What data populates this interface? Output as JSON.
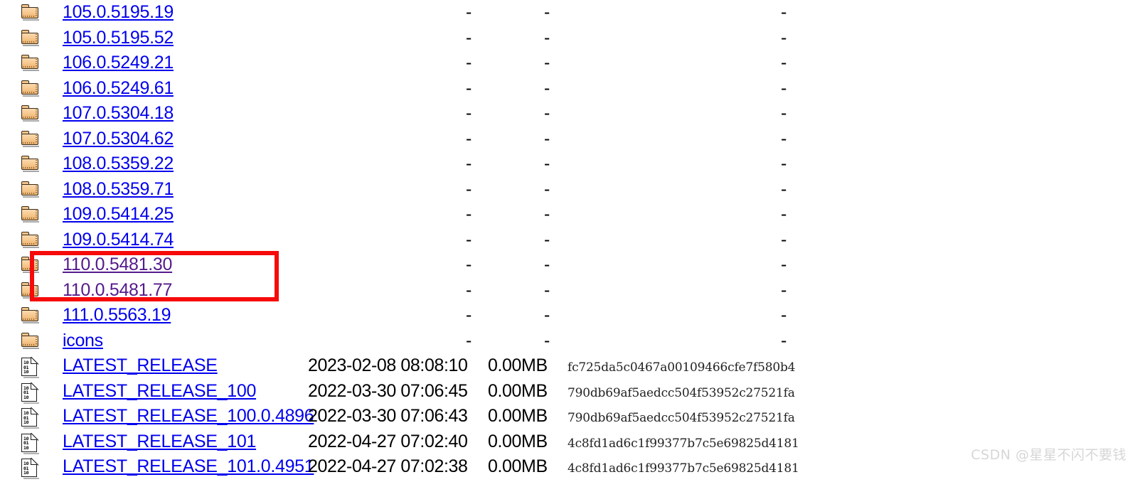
{
  "page": {
    "kind": "apache-directory-listing",
    "link_color": "#0000ee",
    "visited_link_color": "#551a8b",
    "annotation_color": "#f60a0a",
    "watermark": "CSDN @星星不闪不要钱",
    "dash_placeholder": "-"
  },
  "rows": [
    {
      "type": "directory",
      "icon": "folder-icon",
      "name": "105.0.5195.19",
      "visited": false,
      "date": "-",
      "size": "-",
      "hash": "-"
    },
    {
      "type": "directory",
      "icon": "folder-icon",
      "name": "105.0.5195.52",
      "visited": false,
      "date": "-",
      "size": "-",
      "hash": "-"
    },
    {
      "type": "directory",
      "icon": "folder-icon",
      "name": "106.0.5249.21",
      "visited": false,
      "date": "-",
      "size": "-",
      "hash": "-"
    },
    {
      "type": "directory",
      "icon": "folder-icon",
      "name": "106.0.5249.61",
      "visited": false,
      "date": "-",
      "size": "-",
      "hash": "-"
    },
    {
      "type": "directory",
      "icon": "folder-icon",
      "name": "107.0.5304.18",
      "visited": false,
      "date": "-",
      "size": "-",
      "hash": "-"
    },
    {
      "type": "directory",
      "icon": "folder-icon",
      "name": "107.0.5304.62",
      "visited": false,
      "date": "-",
      "size": "-",
      "hash": "-"
    },
    {
      "type": "directory",
      "icon": "folder-icon",
      "name": "108.0.5359.22",
      "visited": false,
      "date": "-",
      "size": "-",
      "hash": "-"
    },
    {
      "type": "directory",
      "icon": "folder-icon",
      "name": "108.0.5359.71",
      "visited": false,
      "date": "-",
      "size": "-",
      "hash": "-"
    },
    {
      "type": "directory",
      "icon": "folder-icon",
      "name": "109.0.5414.25",
      "visited": false,
      "date": "-",
      "size": "-",
      "hash": "-"
    },
    {
      "type": "directory",
      "icon": "folder-icon",
      "name": "109.0.5414.74",
      "visited": false,
      "date": "-",
      "size": "-",
      "hash": "-"
    },
    {
      "type": "directory",
      "icon": "folder-icon",
      "name": "110.0.5481.30",
      "visited": true,
      "date": "-",
      "size": "-",
      "hash": "-"
    },
    {
      "type": "directory",
      "icon": "folder-icon",
      "name": "110.0.5481.77",
      "visited": true,
      "date": "-",
      "size": "-",
      "hash": "-"
    },
    {
      "type": "directory",
      "icon": "folder-icon",
      "name": "111.0.5563.19",
      "visited": false,
      "date": "-",
      "size": "-",
      "hash": "-"
    },
    {
      "type": "directory",
      "icon": "folder-icon",
      "name": "icons",
      "visited": false,
      "date": "-",
      "size": "-",
      "hash": "-"
    },
    {
      "type": "file",
      "icon": "binary-file-icon",
      "name": "LATEST_RELEASE",
      "visited": false,
      "date": "2023-02-08 08:08:10",
      "size": "0.00MB",
      "hash": "fc725da5c0467a00109466cfe7f580b4"
    },
    {
      "type": "file",
      "icon": "binary-file-icon",
      "name": "LATEST_RELEASE_100",
      "visited": false,
      "date": "2022-03-30 07:06:45",
      "size": "0.00MB",
      "hash": "790db69af5aedcc504f53952c27521fa"
    },
    {
      "type": "file",
      "icon": "binary-file-icon",
      "name": "LATEST_RELEASE_100.0.4896",
      "visited": false,
      "date": "2022-03-30 07:06:43",
      "size": "0.00MB",
      "hash": "790db69af5aedcc504f53952c27521fa"
    },
    {
      "type": "file",
      "icon": "binary-file-icon",
      "name": "LATEST_RELEASE_101",
      "visited": false,
      "date": "2022-04-27 07:02:40",
      "size": "0.00MB",
      "hash": "4c8fd1ad6c1f99377b7c5e69825d4181"
    },
    {
      "type": "file",
      "icon": "binary-file-icon",
      "name": "LATEST_RELEASE_101.0.4951",
      "visited": false,
      "date": "2022-04-27 07:02:38",
      "size": "0.00MB",
      "hash": "4c8fd1ad6c1f99377b7c5e69825d4181"
    }
  ],
  "annotation": {
    "shape": "rectangle",
    "highlights": [
      "110.0.5481.30",
      "110.0.5481.77"
    ]
  }
}
